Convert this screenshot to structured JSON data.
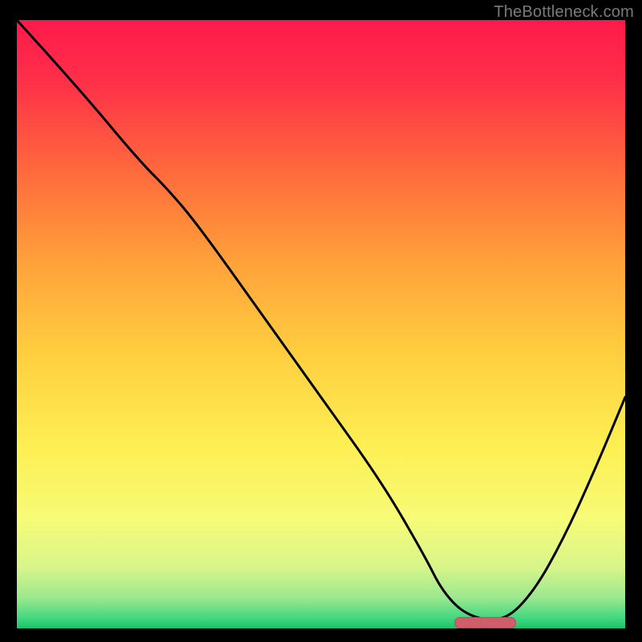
{
  "watermark": "TheBottleneck.com",
  "chart_data": {
    "type": "line",
    "title": "",
    "xlabel": "",
    "ylabel": "",
    "xlim": [
      0,
      100
    ],
    "ylim": [
      0,
      100
    ],
    "grid": false,
    "series": [
      {
        "name": "bottleneck-curve",
        "x": [
          0,
          10,
          20,
          25,
          30,
          40,
          50,
          60,
          67,
          70,
          74,
          80,
          85,
          90,
          95,
          100
        ],
        "values": [
          100,
          89,
          77,
          72,
          66,
          52,
          38,
          24,
          12,
          6,
          2,
          1,
          6,
          15,
          26,
          38
        ]
      }
    ],
    "marker": {
      "name": "optimal-range",
      "x_start": 72,
      "x_end": 82,
      "y": 1
    },
    "background_gradient": {
      "stops": [
        {
          "offset": 0,
          "color": "#ff1a4b"
        },
        {
          "offset": 0.1,
          "color": "#ff2f49"
        },
        {
          "offset": 0.25,
          "color": "#ff6a3c"
        },
        {
          "offset": 0.4,
          "color": "#ffa23a"
        },
        {
          "offset": 0.55,
          "color": "#ffcf3f"
        },
        {
          "offset": 0.7,
          "color": "#fdef53"
        },
        {
          "offset": 0.82,
          "color": "#f7fb77"
        },
        {
          "offset": 0.9,
          "color": "#d7f58a"
        },
        {
          "offset": 0.95,
          "color": "#9ae88f"
        },
        {
          "offset": 0.985,
          "color": "#3dd67e"
        },
        {
          "offset": 1.0,
          "color": "#18c46a"
        }
      ]
    },
    "colors": {
      "curve": "#000000",
      "marker_fill": "#cf5d6a",
      "marker_stroke": "#bb4c5a"
    }
  }
}
